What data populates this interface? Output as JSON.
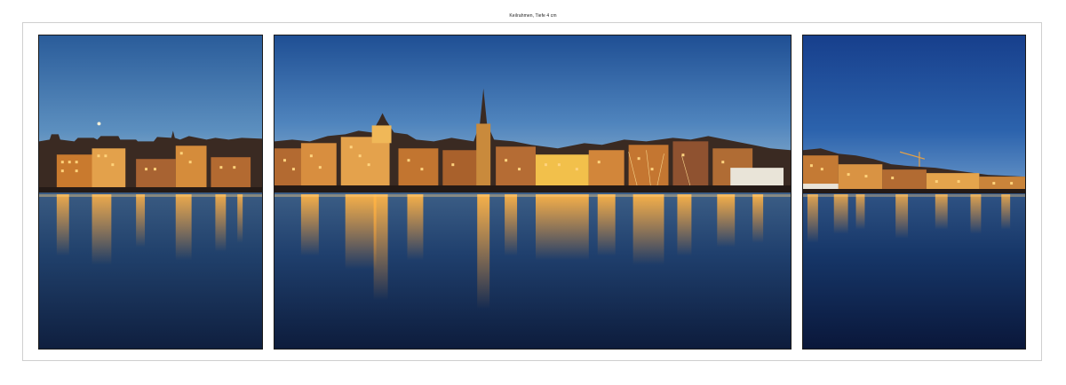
{
  "caption": "Keilrahmen, Tiefe 4 cm",
  "canvas_panels": [
    {
      "position": "left",
      "scene": "harbor-night-left-section"
    },
    {
      "position": "center",
      "scene": "harbor-night-center-section"
    },
    {
      "position": "right",
      "scene": "harbor-night-right-section"
    }
  ],
  "colors": {
    "sky_top": "#1f4a8a",
    "sky_bottom": "#9fc0d6",
    "water_deep": "#0e1e3e",
    "lights": "#ffb23a"
  }
}
